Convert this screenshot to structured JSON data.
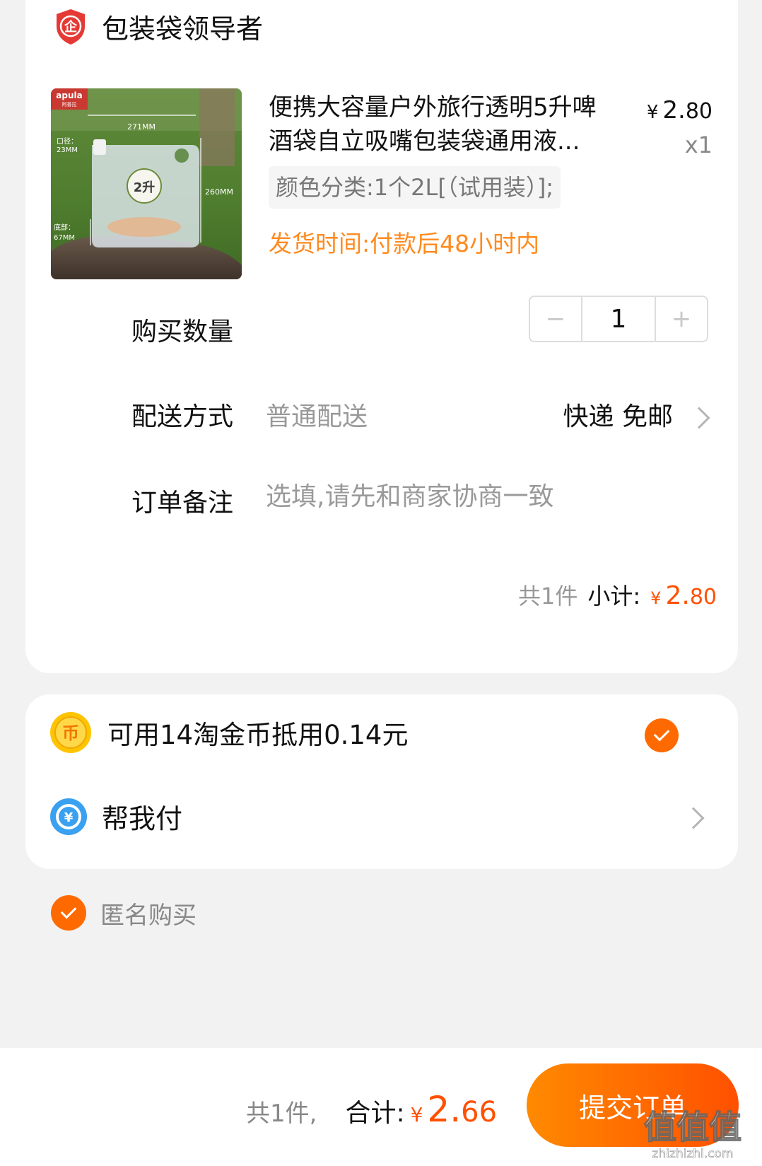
{
  "shop": {
    "name": "包装袋领导者",
    "icon_text": "企"
  },
  "product": {
    "title": "便携大容量户外旅行透明5升啤酒袋自立吸嘴包装袋通用液...",
    "price_yen": "¥",
    "price_int": "2.",
    "price_cents": "80",
    "quantity": "x1",
    "sku": "颜色分类:1个2L[（试用装）];",
    "ship_time": "发货时间:付款后48小时内",
    "image_texts": {
      "brand": "apula",
      "brand_sub": "阿普拉",
      "width": "271MM",
      "mouth": "口径：",
      "mouth_size": "23MM",
      "capacity": "2升",
      "height": "260MM",
      "bottom": "底部：",
      "bottom_size": "67MM"
    }
  },
  "purchase_qty": {
    "label": "购买数量",
    "minus": "−",
    "value": "1",
    "plus": "+"
  },
  "delivery": {
    "label": "配送方式",
    "method": "普通配送",
    "value": "快递 免邮"
  },
  "note": {
    "label": "订单备注",
    "placeholder": "选填,请先和商家协商一致"
  },
  "subtotal": {
    "count": "共1件",
    "label": "小计:",
    "yen": "¥",
    "int": "2.",
    "cents": "80"
  },
  "coin": {
    "icon_text": "币",
    "text": "可用14淘金币抵用0.14元",
    "checked": true
  },
  "help_pay": {
    "icon_text": "¥",
    "text": "帮我付"
  },
  "anonymous": {
    "text": "匿名购买",
    "checked": true
  },
  "footer": {
    "count": "共1件,",
    "label": "合计:",
    "yen": "¥",
    "int": "2.",
    "cents": "66",
    "submit": "提交订单"
  },
  "watermark": {
    "text": "值值值",
    "sub": "zhizhizhi.com"
  },
  "colors": {
    "accent": "#ff5000",
    "orange": "#ff8a1f",
    "check": "#ff6a00",
    "shop_icon": "#e53935",
    "coin": "#ffc400",
    "help_icon": "#3aa0f0"
  }
}
